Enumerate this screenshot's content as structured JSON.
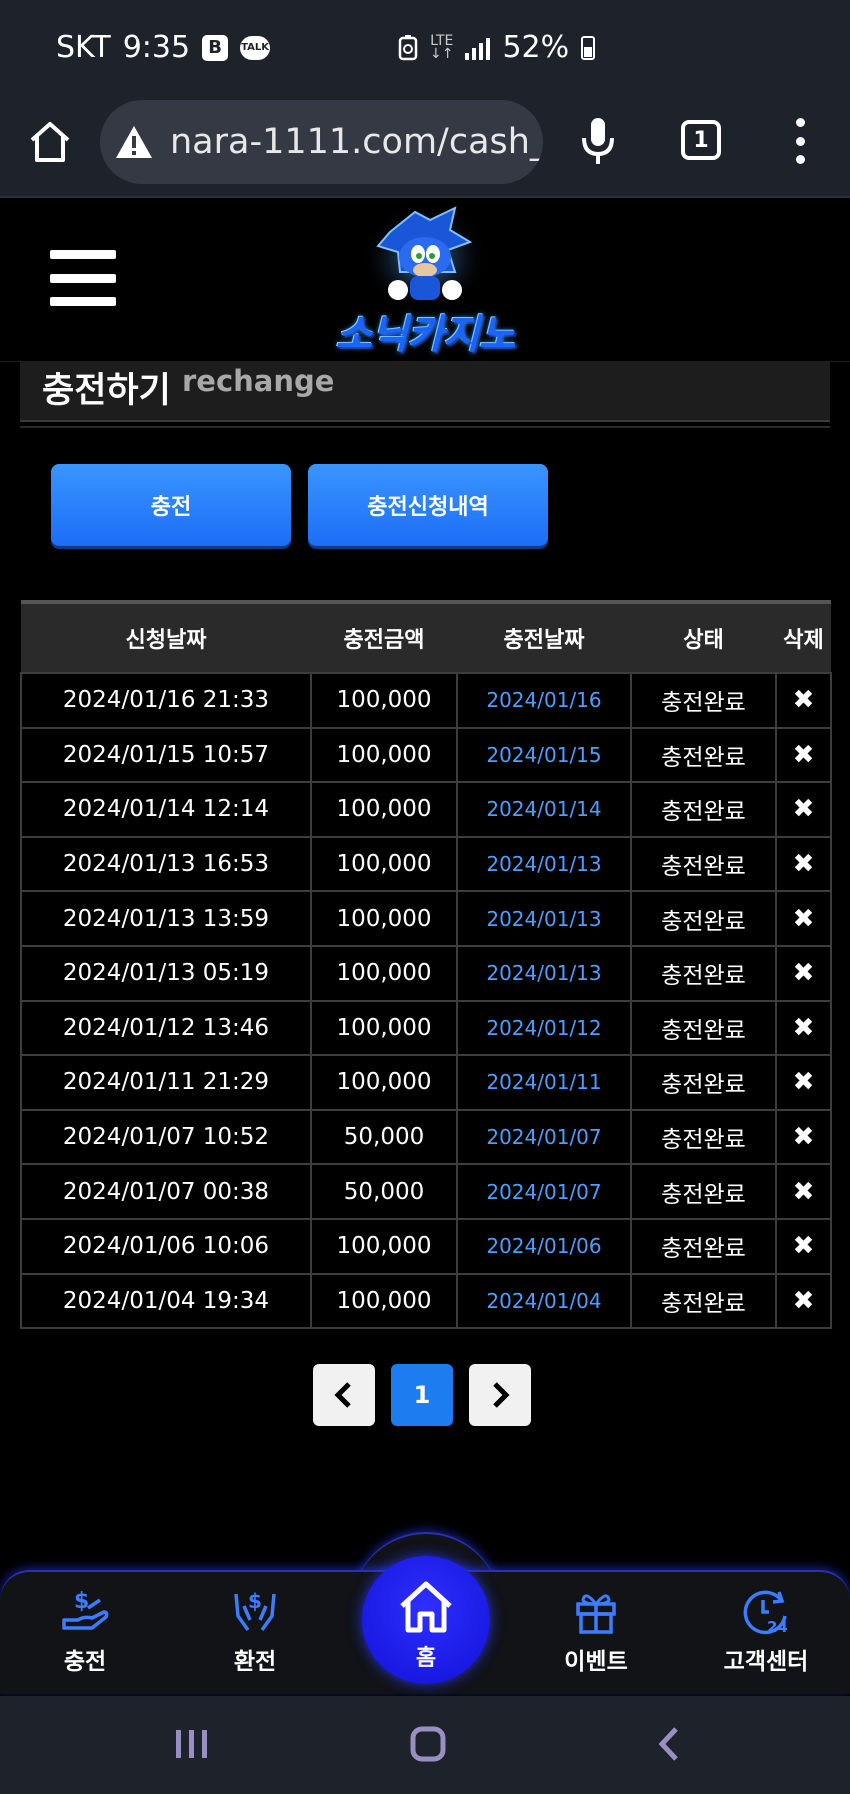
{
  "status_bar": {
    "carrier": "SKT",
    "time": "9:35",
    "badge_b": "B",
    "badge_talk": "TALK",
    "network_top": "LTE",
    "network_bottom": "↓↑",
    "battery": "52%"
  },
  "browser": {
    "url": "nara-1111.com/cash_(",
    "tab_count": "1"
  },
  "header": {
    "logo_text": "소닉카지노"
  },
  "page_title": {
    "main": "충전하기",
    "sub": "rechange"
  },
  "buttons": {
    "charge": "충전",
    "history": "충전신청내역"
  },
  "table": {
    "headers": [
      "신청날짜",
      "충전금액",
      "충전날짜",
      "상태",
      "삭제"
    ],
    "rows": [
      {
        "request_date": "2024/01/16 21:33",
        "amount": "100,000",
        "charge_date": "2024/01/16",
        "status": "충전완료"
      },
      {
        "request_date": "2024/01/15 10:57",
        "amount": "100,000",
        "charge_date": "2024/01/15",
        "status": "충전완료"
      },
      {
        "request_date": "2024/01/14 12:14",
        "amount": "100,000",
        "charge_date": "2024/01/14",
        "status": "충전완료"
      },
      {
        "request_date": "2024/01/13 16:53",
        "amount": "100,000",
        "charge_date": "2024/01/13",
        "status": "충전완료"
      },
      {
        "request_date": "2024/01/13 13:59",
        "amount": "100,000",
        "charge_date": "2024/01/13",
        "status": "충전완료"
      },
      {
        "request_date": "2024/01/13 05:19",
        "amount": "100,000",
        "charge_date": "2024/01/13",
        "status": "충전완료"
      },
      {
        "request_date": "2024/01/12 13:46",
        "amount": "100,000",
        "charge_date": "2024/01/12",
        "status": "충전완료"
      },
      {
        "request_date": "2024/01/11 21:29",
        "amount": "100,000",
        "charge_date": "2024/01/11",
        "status": "충전완료"
      },
      {
        "request_date": "2024/01/07 10:52",
        "amount": "50,000",
        "charge_date": "2024/01/07",
        "status": "충전완료"
      },
      {
        "request_date": "2024/01/07 00:38",
        "amount": "50,000",
        "charge_date": "2024/01/07",
        "status": "충전완료"
      },
      {
        "request_date": "2024/01/06 10:06",
        "amount": "100,000",
        "charge_date": "2024/01/06",
        "status": "충전완료"
      },
      {
        "request_date": "2024/01/04 19:34",
        "amount": "100,000",
        "charge_date": "2024/01/04",
        "status": "충전완료"
      }
    ],
    "delete_glyph": "✖"
  },
  "pagination": {
    "prev": "‹",
    "current": "1",
    "next": "›"
  },
  "bottom_nav": {
    "items": [
      {
        "label": "충전",
        "icon": "hand-dollar-icon"
      },
      {
        "label": "환전",
        "icon": "hands-dollar-icon"
      },
      {
        "label": "홈",
        "icon": "home-icon"
      },
      {
        "label": "이벤트",
        "icon": "gift-icon"
      },
      {
        "label": "고객센터",
        "icon": "clock-24-icon"
      }
    ]
  },
  "colors": {
    "accent_blue": "#1c7cf0",
    "link_blue": "#4d9fff",
    "nav_glow": "#2a2fb8"
  }
}
